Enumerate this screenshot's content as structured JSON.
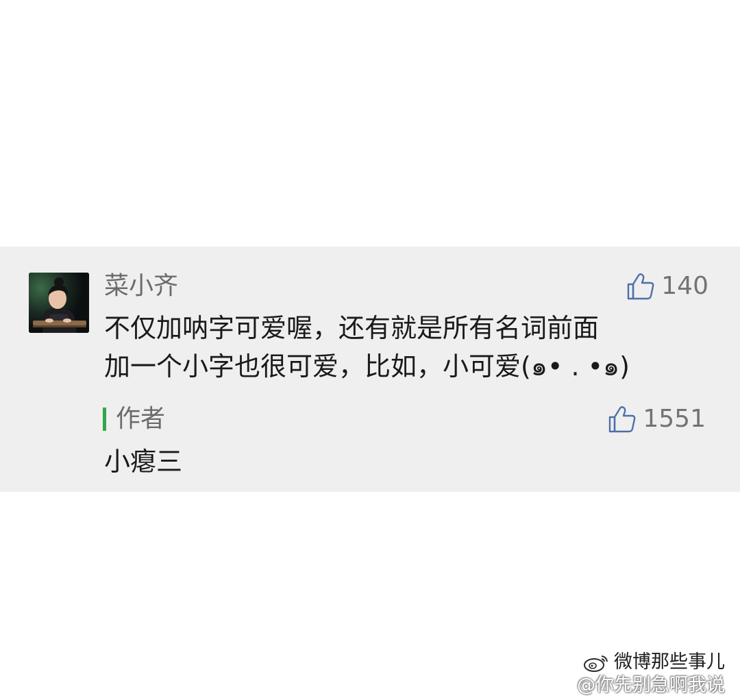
{
  "comment": {
    "username": "菜小齐",
    "likes": "140",
    "text_lines": [
      "不仅加呐字可爱喔，还有就是所有名词前面",
      "加一个小字也很可爱，比如，小可爱(๑• . •๑)"
    ]
  },
  "author_reply": {
    "tag": "作者",
    "likes": "1551",
    "text": "小瘪三"
  },
  "watermark": {
    "account": "微博那些事儿",
    "handle": "@你先别急啊我说"
  },
  "icons": {
    "like": "thumbs-up-icon",
    "watermark_logo": "weibo-logo-icon"
  },
  "colors": {
    "panel_background": "#efefef",
    "author_bar": "#2ea84a",
    "username": "#6b6b6b",
    "text": "#1a1a1a"
  }
}
